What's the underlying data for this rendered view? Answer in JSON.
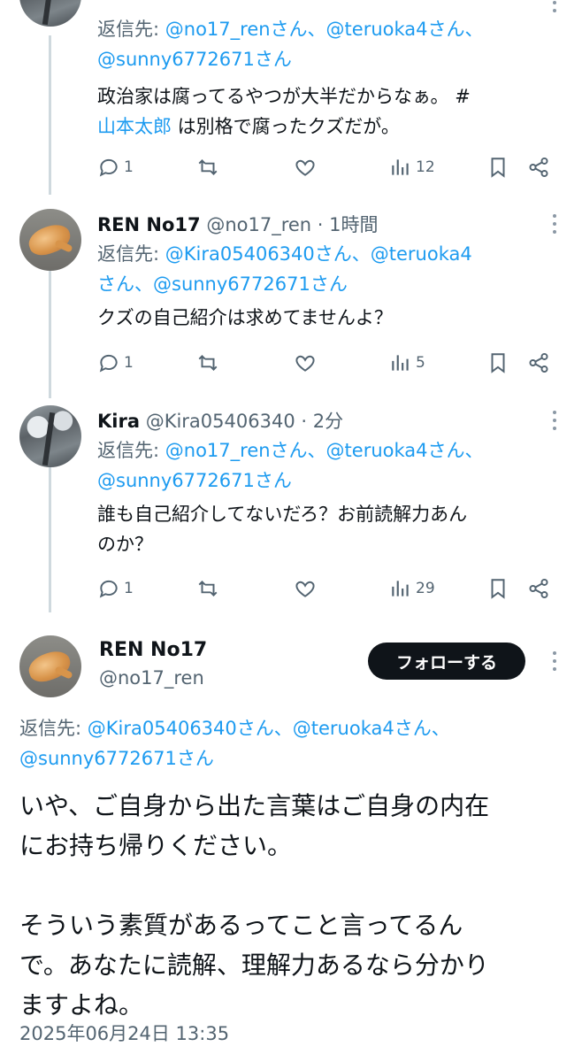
{
  "tweets": [
    {
      "reply_prefix": "返信先: ",
      "reply_mentions_line1": "@no17_renさん、@teruoka4さん、",
      "reply_mentions_line2": "@sunny6772671さん",
      "text_line1": "政治家は腐ってるやつが大半だからなぁ。 #",
      "text_tag_line2": "山本太郎",
      "text_line2_rest": " は別格で腐ったクズだが。",
      "replies": "1",
      "views": "12"
    },
    {
      "name": "REN No17",
      "handle": "@no17_ren",
      "time": " · 1時間",
      "reply_prefix": "返信先: ",
      "reply_mentions_line1": "@Kira05406340さん、@teruoka4",
      "reply_mentions_line2": "さん、@sunny6772671さん",
      "text": "クズの自己紹介は求めてませんよ？",
      "replies": "1",
      "views": "5"
    },
    {
      "name": "Kira",
      "handle": "@Kira05406340",
      "time": " · 2分",
      "reply_prefix": "返信先: ",
      "reply_mentions_line1": "@no17_renさん、@teruoka4さん、",
      "reply_mentions_line2": "@sunny6772671さん",
      "text_line1": "誰も自己紹介してないだろ？お前読解力あん",
      "text_line2": "のか？",
      "replies": "1",
      "views": "29"
    }
  ],
  "main_tweet": {
    "name": "REN No17",
    "handle": "@no17_ren",
    "follow_label": "フォローする",
    "reply_prefix": "返信先: ",
    "reply_mentions_line1": "@Kira05406340さん、@teruoka4さん、",
    "reply_mentions_line2": "@sunny6772671さん",
    "text_lines": [
      "いや、ご自身から出た言葉はご自身の内在",
      "にお持ち帰りください。",
      "",
      "そういう素質があるってこと言ってるん",
      "で。あなたに読解、理解力あるなら分かり",
      "ますよね。"
    ],
    "timestamp": "2025年06月24日 13:35"
  },
  "icons": {
    "reply": "reply-icon",
    "retweet": "retweet-icon",
    "like": "heart-icon",
    "views": "views-icon",
    "bookmark": "bookmark-icon",
    "share": "share-icon"
  },
  "colors": {
    "link": "#1d9bf0",
    "secondary": "#536471",
    "button": "#0f1419"
  }
}
